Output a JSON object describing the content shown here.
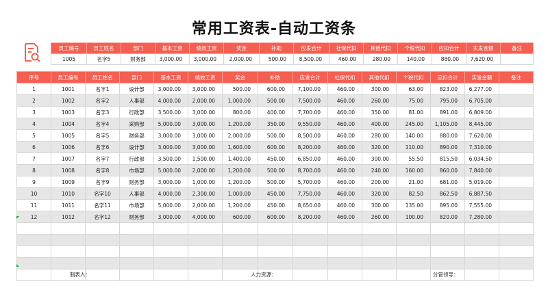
{
  "title": "常用工资表-自动工资条",
  "icon": "document-search-icon",
  "accent_color": "#f45f52",
  "slip": {
    "headers": [
      "员工编号",
      "员工姓名",
      "部门",
      "基本工资",
      "绩效工资",
      "奖金",
      "补助",
      "应发合计",
      "社保代扣",
      "其他代扣",
      "个税代扣",
      "应扣合计",
      "实发金额",
      "备注"
    ],
    "row": [
      "1005",
      "名字5",
      "财务部",
      "3,000.00",
      "3,000.00",
      "2,000.00",
      "500.00",
      "8,500.00",
      "460.00",
      "280.00",
      "140.00",
      "880.00",
      "7,620.00",
      ""
    ]
  },
  "main": {
    "headers": [
      "序号",
      "员工编号",
      "员工姓名",
      "部门",
      "基本工资",
      "绩效工资",
      "奖金",
      "补助",
      "应发合计",
      "社保代扣",
      "其他代扣",
      "个税代扣",
      "应扣合计",
      "实发金额",
      "备注"
    ],
    "rows": [
      [
        "1",
        "1001",
        "名字1",
        "设计部",
        "3,000.00",
        "3,000.00",
        "500.00",
        "600.00",
        "7,100.00",
        "460.00",
        "300.00",
        "63.00",
        "823.00",
        "6,277.00",
        ""
      ],
      [
        "2",
        "1002",
        "名字2",
        "人事部",
        "4,000.00",
        "2,000.00",
        "1,000.00",
        "500.00",
        "7,500.00",
        "460.00",
        "260.00",
        "75.00",
        "795.00",
        "6,705.00",
        ""
      ],
      [
        "3",
        "1003",
        "名字3",
        "行政部",
        "3,500.00",
        "3,000.00",
        "800.00",
        "400.00",
        "7,700.00",
        "460.00",
        "350.00",
        "81.00",
        "891.00",
        "6,809.00",
        ""
      ],
      [
        "4",
        "1004",
        "名字4",
        "采购部",
        "5,000.00",
        "3,000.00",
        "1,200.00",
        "350.00",
        "9,550.00",
        "460.00",
        "400.00",
        "245.00",
        "1,105.00",
        "8,445.00",
        ""
      ],
      [
        "5",
        "1005",
        "名字5",
        "财务部",
        "3,000.00",
        "3,000.00",
        "2,000.00",
        "500.00",
        "8,500.00",
        "460.00",
        "280.00",
        "140.00",
        "880.00",
        "7,620.00",
        ""
      ],
      [
        "6",
        "1006",
        "名字6",
        "设计部",
        "3,000.00",
        "3,000.00",
        "1,600.00",
        "600.00",
        "8,200.00",
        "460.00",
        "320.00",
        "110.00",
        "890.00",
        "7,310.00",
        ""
      ],
      [
        "7",
        "1007",
        "名字7",
        "行政部",
        "3,500.00",
        "1,500.00",
        "1,400.00",
        "450.00",
        "6,850.00",
        "460.00",
        "300.00",
        "55.50",
        "815.50",
        "6,034.50",
        ""
      ],
      [
        "8",
        "1008",
        "名字8",
        "市场部",
        "5,000.00",
        "2,000.00",
        "1,200.00",
        "500.00",
        "8,700.00",
        "460.00",
        "240.00",
        "160.00",
        "860.00",
        "7,840.00",
        ""
      ],
      [
        "9",
        "1009",
        "名字9",
        "财务部",
        "3,000.00",
        "1,000.00",
        "1,200.00",
        "500.00",
        "5,700.00",
        "460.00",
        "200.00",
        "21.00",
        "681.00",
        "5,019.00",
        ""
      ],
      [
        "10",
        "1010",
        "名字10",
        "人事部",
        "4,000.00",
        "2,300.00",
        "1,000.00",
        "450.00",
        "7,750.00",
        "460.00",
        "320.00",
        "82.50",
        "862.50",
        "6,887.50",
        ""
      ],
      [
        "11",
        "1011",
        "名字11",
        "市场部",
        "5,000.00",
        "2,000.00",
        "1,200.00",
        "450.00",
        "8,650.00",
        "460.00",
        "300.00",
        "135.00",
        "895.00",
        "7,555.00",
        ""
      ],
      [
        "12",
        "1012",
        "名字12",
        "财务部",
        "3,000.00",
        "4,000.00",
        "600.00",
        "600.00",
        "8,200.00",
        "460.00",
        "260.00",
        "100.00",
        "820.00",
        "7,280.00",
        ""
      ]
    ],
    "empty_rows": 5
  },
  "footer": {
    "preparer": "制表人：",
    "hr": "人力资源：",
    "leader": "分管领导："
  }
}
